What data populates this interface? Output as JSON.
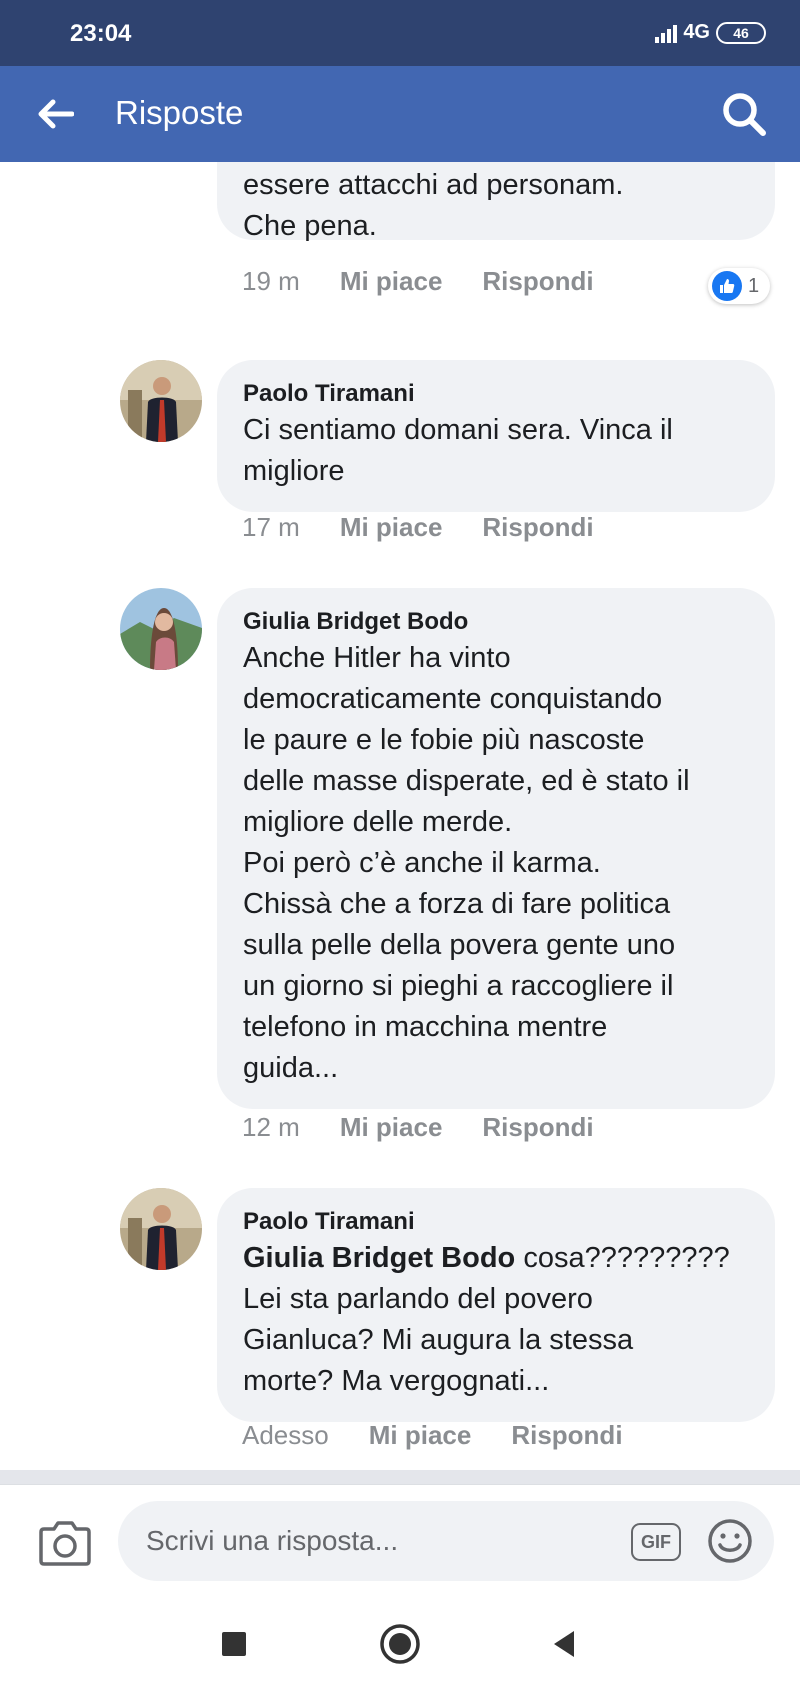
{
  "status_bar": {
    "time": "23:04",
    "network": "4G",
    "battery": "46"
  },
  "header": {
    "title": "Risposte"
  },
  "comments": [
    {
      "author": "",
      "text": "argomentazioni continuino ad\nessere attacchi ad personam.\nChe pena.",
      "time": "19 m",
      "like_label": "Mi piace",
      "reply_label": "Rispondi",
      "reaction_count": "1"
    },
    {
      "author": "Paolo Tiramani",
      "text": "Ci sentiamo domani sera. Vinca il\nmigliore",
      "time": "17 m",
      "like_label": "Mi piace",
      "reply_label": "Rispondi"
    },
    {
      "author": "Giulia Bridget Bodo",
      "text": "Anche Hitler ha vinto\ndemocraticamente conquistando\nle paure e le fobie più nascoste\ndelle masse disperate, ed è stato il\nmigliore delle merde.\nPoi però c’è anche il karma.\nChissà che a forza di fare politica\nsulla pelle della povera gente uno\nun giorno si pieghi a raccogliere il\ntelefono in macchina mentre\nguida...",
      "time": "12 m",
      "like_label": "Mi piace",
      "reply_label": "Rispondi"
    },
    {
      "author": "Paolo Tiramani",
      "mention": "Giulia Bridget Bodo",
      "text_after_mention": " cosa?????????",
      "text": "Lei sta parlando del povero\nGianluca? Mi augura la stessa\nmorte? Ma vergognati...",
      "time": "Adesso",
      "like_label": "Mi piace",
      "reply_label": "Rispondi"
    }
  ],
  "composer": {
    "placeholder": "Scrivi una risposta...",
    "gif_label": "GIF"
  },
  "colors": {
    "status_bar": "#2f4370",
    "app_bar": "#4267b2",
    "bubble": "#f0f2f5",
    "meta_text": "#8a8d91",
    "like_blue": "#1877f2"
  },
  "icons": [
    "back-arrow-icon",
    "search-icon",
    "like-icon",
    "camera-icon",
    "gif-icon",
    "emoji-icon",
    "nav-recents-icon",
    "nav-home-icon",
    "nav-back-icon"
  ]
}
